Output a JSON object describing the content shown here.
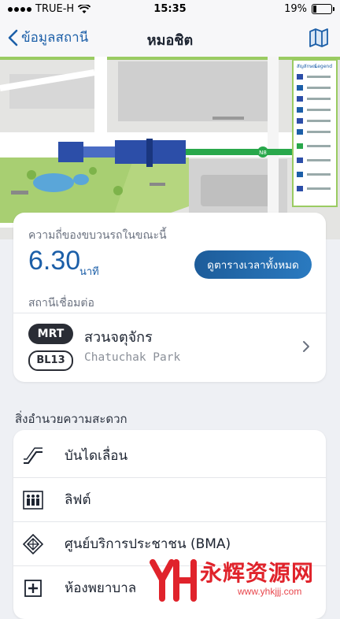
{
  "status_bar": {
    "carrier": "TRUE-H",
    "time": "15:35",
    "battery": "19%"
  },
  "nav": {
    "back_label": "ข้อมูลสถานี",
    "title": "หมอชิต"
  },
  "map": {
    "legend_title": "สัญลักษณ์",
    "legend_title_en": "Legend",
    "station_badge": "N8",
    "colors": {
      "park": "#a8cf72",
      "lake": "#5aa6d9",
      "line": "#29a84b",
      "station": "#2c4ea8",
      "road": "#ffffff",
      "block": "#cfcfcf"
    }
  },
  "frequency": {
    "label": "ความถี่ของขบวนรถในขณะนี้",
    "value": "6.30",
    "unit": "นาที",
    "timetable_button": "ดูตารางเวลาทั้งหมด"
  },
  "connection": {
    "label": "สถานีเชื่อมต่อ",
    "line_badge": "MRT",
    "station_code": "BL13",
    "station_name_th": "สวนจตุจักร",
    "station_name_en": "Chatuchak Park"
  },
  "facilities": {
    "title": "สิ่งอำนวยความสะดวก",
    "items": [
      {
        "label": "บันไดเลื่อน",
        "icon": "escalator-icon"
      },
      {
        "label": "ลิฟต์",
        "icon": "elevator-icon"
      },
      {
        "label": "ศูนย์บริการประชาชน (BMA)",
        "icon": "service-center-icon"
      },
      {
        "label": "ห้องพยาบาล",
        "icon": "first-aid-icon"
      }
    ]
  },
  "watermark": {
    "text": "永辉资源网",
    "url": "www.yhkjjj.com"
  },
  "colors": {
    "accent": "#1c5fa8",
    "badge": "#2a2d35",
    "background": "#eef0f4",
    "watermark": "#e0232b"
  }
}
